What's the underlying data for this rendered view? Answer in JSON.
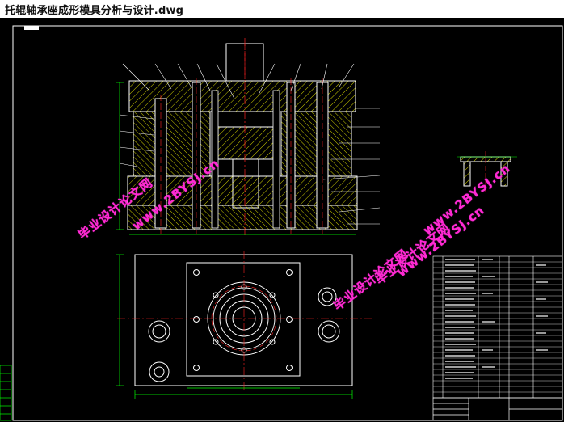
{
  "window": {
    "title": "托辊轴承座成形模具分析与设计.dwg"
  },
  "watermarks": [
    {
      "text": "毕业设计论文网"
    },
    {
      "text": "www.2BYSJ.cn"
    },
    {
      "text": "毕业设计论文网"
    },
    {
      "text": "www.2BYSJ.cn"
    },
    {
      "text": "毕业设计论文网"
    },
    {
      "text": "www.2BYSJ.cn"
    }
  ],
  "colors": {
    "outline": "#ffffff",
    "hatch": "#ffff00",
    "centerline": "#ff2020",
    "dimension": "#00ff00",
    "watermark": "#ff2ad4"
  }
}
